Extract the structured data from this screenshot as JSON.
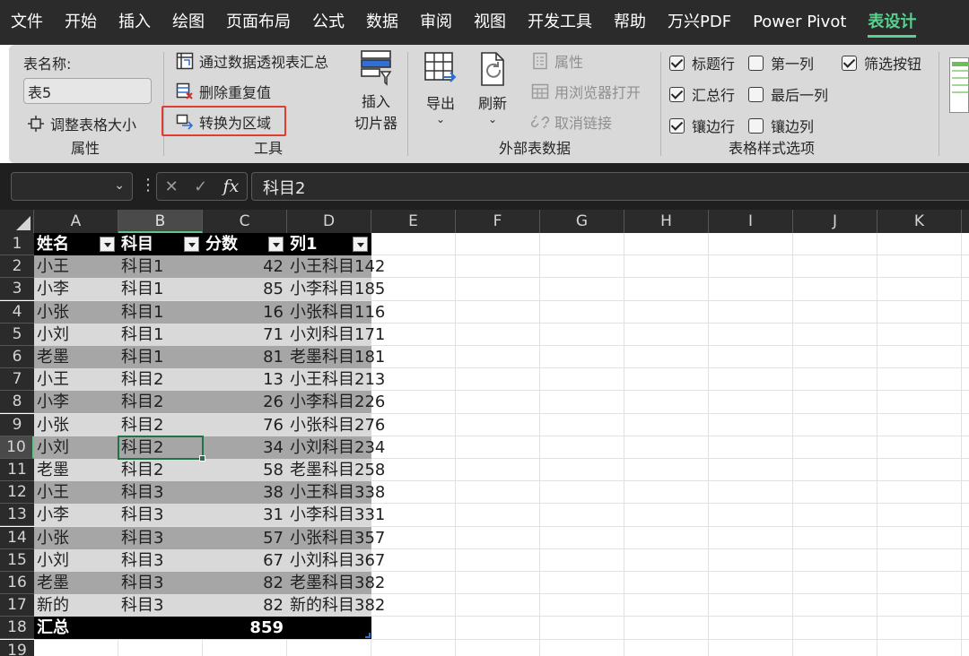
{
  "menu": {
    "items": [
      "文件",
      "开始",
      "插入",
      "绘图",
      "页面布局",
      "公式",
      "数据",
      "审阅",
      "视图",
      "开发工具",
      "帮助",
      "万兴PDF",
      "Power Pivot",
      "表设计"
    ],
    "active": "表设计"
  },
  "ribbon": {
    "properties": {
      "label": "表名称:",
      "table_name": "表5",
      "resize": "调整表格大小",
      "group": "属性"
    },
    "tools": {
      "pivot": "通过数据透视表汇总",
      "remove_dup": "删除重复值",
      "convert": "转换为区域",
      "slicer_line1": "插入",
      "slicer_line2": "切片器",
      "group": "工具"
    },
    "external": {
      "export": "导出",
      "refresh": "刷新",
      "properties": "属性",
      "open_browser": "用浏览器打开",
      "unlink": "取消链接",
      "group": "外部表数据"
    },
    "style_options": {
      "header_row": {
        "label": "标题行",
        "checked": true
      },
      "total_row": {
        "label": "汇总行",
        "checked": true
      },
      "banded_rows": {
        "label": "镶边行",
        "checked": true
      },
      "first_col": {
        "label": "第一列",
        "checked": false
      },
      "last_col": {
        "label": "最后一列",
        "checked": false
      },
      "banded_cols": {
        "label": "镶边列",
        "checked": false
      },
      "filter_btn": {
        "label": "筛选按钮",
        "checked": true
      },
      "group": "表格样式选项"
    }
  },
  "formula_bar": {
    "name_box": "",
    "fx": "fx",
    "formula": "科目2"
  },
  "grid": {
    "columns": [
      "A",
      "B",
      "C",
      "D",
      "E",
      "F",
      "G",
      "H",
      "I",
      "J",
      "K"
    ],
    "rows": [
      "1",
      "2",
      "3",
      "4",
      "5",
      "6",
      "7",
      "8",
      "9",
      "10",
      "11",
      "12",
      "13",
      "14",
      "15",
      "16",
      "17",
      "18",
      "19"
    ],
    "table_header": [
      "姓名",
      "科目",
      "分数",
      "列1"
    ],
    "table_rows": [
      [
        "小王",
        "科目1",
        "42",
        "小王科目142"
      ],
      [
        "小李",
        "科目1",
        "85",
        "小李科目185"
      ],
      [
        "小张",
        "科目1",
        "16",
        "小张科目116"
      ],
      [
        "小刘",
        "科目1",
        "71",
        "小刘科目171"
      ],
      [
        "老墨",
        "科目1",
        "81",
        "老墨科目181"
      ],
      [
        "小王",
        "科目2",
        "13",
        "小王科目213"
      ],
      [
        "小李",
        "科目2",
        "26",
        "小李科目226"
      ],
      [
        "小张",
        "科目2",
        "76",
        "小张科目276"
      ],
      [
        "小刘",
        "科目2",
        "34",
        "小刘科目234"
      ],
      [
        "老墨",
        "科目2",
        "58",
        "老墨科目258"
      ],
      [
        "小王",
        "科目3",
        "38",
        "小王科目338"
      ],
      [
        "小李",
        "科目3",
        "31",
        "小李科目331"
      ],
      [
        "小张",
        "科目3",
        "57",
        "小张科目357"
      ],
      [
        "小刘",
        "科目3",
        "67",
        "小刘科目367"
      ],
      [
        "老墨",
        "科目3",
        "82",
        "老墨科目382"
      ],
      [
        "新的",
        "科目3",
        "82",
        "新的科目382"
      ]
    ],
    "total_row": [
      "汇总",
      "",
      "859",
      ""
    ],
    "selected_column": "B",
    "selected_row": "10",
    "colors": {
      "band_dark": "#a6a6a6",
      "band_light": "#d9d9d9",
      "header_bg": "#000000",
      "accent": "#59d18f"
    }
  }
}
